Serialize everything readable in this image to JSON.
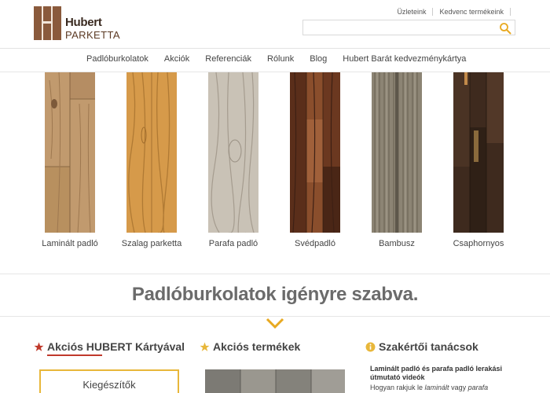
{
  "brand": {
    "name": "Hubert",
    "sub": "PARKETTA"
  },
  "top_links": [
    "Üzleteink",
    "Kedvenc termékeink"
  ],
  "search": {
    "placeholder": ""
  },
  "nav": [
    "Padlóburkolatok",
    "Akciók",
    "Referenciák",
    "Rólunk",
    "Blog",
    "Hubert Barát kedvezménykártya"
  ],
  "products": [
    {
      "label": "Laminált padló",
      "color": "#c19a6e"
    },
    {
      "label": "Szalag parketta",
      "color": "#d69a4a"
    },
    {
      "label": "Parafa padló",
      "color": "#c9c2b6"
    },
    {
      "label": "Svédpadló",
      "color": "#6e3a22"
    },
    {
      "label": "Bambusz",
      "color": "#8c8474"
    },
    {
      "label": "Csaphornyos",
      "color": "#3e2a1e"
    }
  ],
  "banner": {
    "title": "Padlóburkolatok igényre szabva."
  },
  "columns": {
    "left": {
      "title": "Akciós HUBERT Kártyával",
      "box_label": "Kiegészítők"
    },
    "middle": {
      "title": "Akciós termékek"
    },
    "right": {
      "title": "Szakértői tanácsok",
      "article_title": "Laminált padló és parafa padló lerakási útmutató videók",
      "article_desc_prefix": "Hogyan rakjuk le ",
      "article_desc_em1": "laminált",
      "article_desc_mid": " vagy ",
      "article_desc_em2": "parafa"
    }
  },
  "colors": {
    "accent_yellow": "#e8b73a",
    "star_red": "#c0392b",
    "brand_brown": "#8a5a3c"
  }
}
